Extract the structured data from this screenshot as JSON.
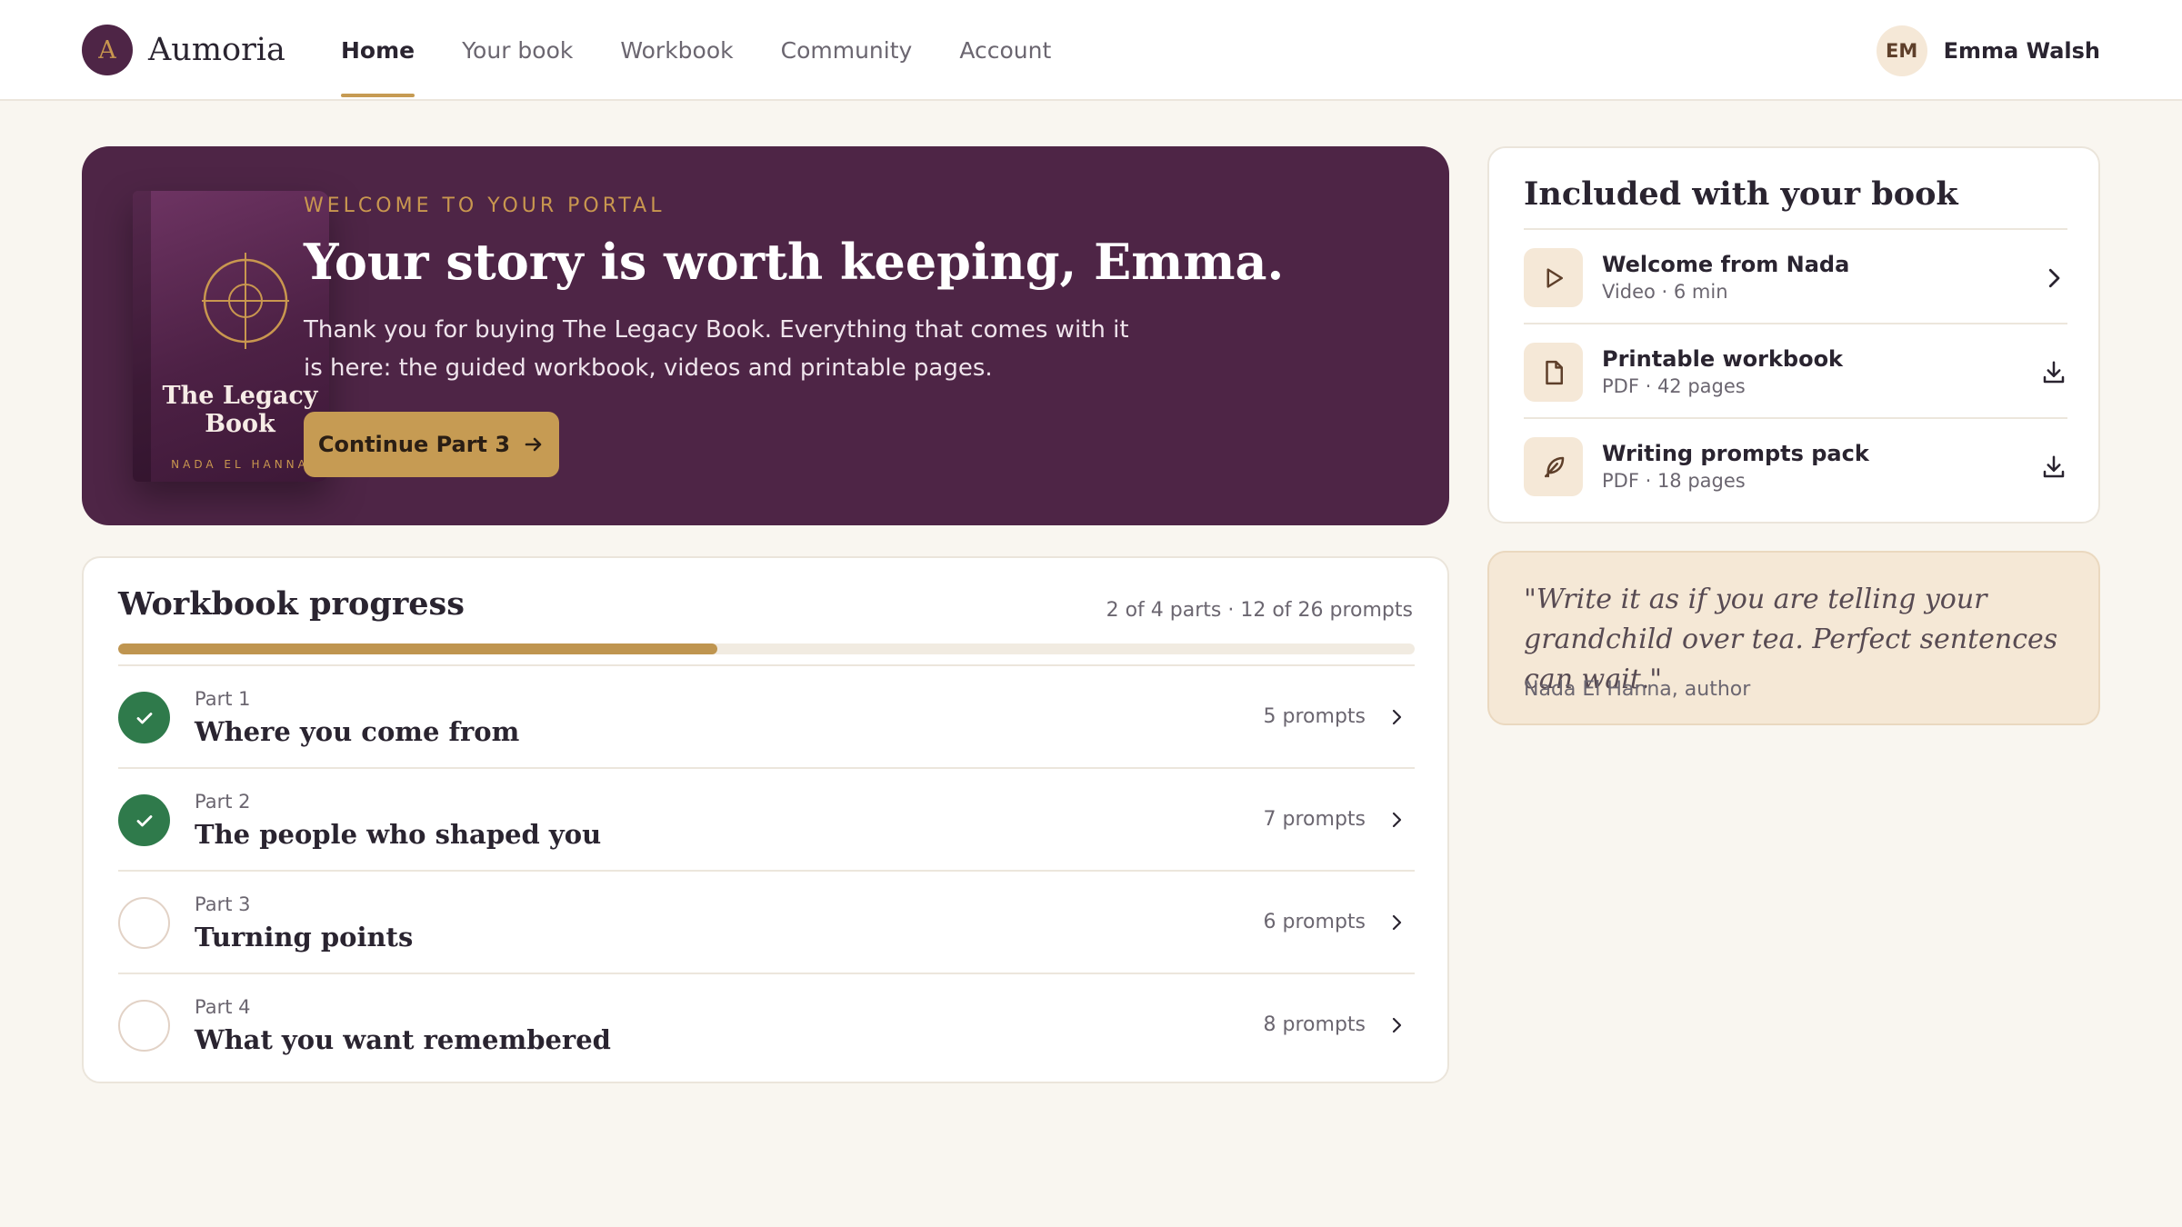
{
  "brand": {
    "logo_letter": "A",
    "name": "Aumoria"
  },
  "nav": {
    "items": [
      {
        "label": "Home",
        "active": true
      },
      {
        "label": "Your book",
        "active": false
      },
      {
        "label": "Workbook",
        "active": false
      },
      {
        "label": "Community",
        "active": false
      },
      {
        "label": "Account",
        "active": false
      }
    ]
  },
  "user": {
    "initials": "EM",
    "name": "Emma Walsh"
  },
  "hero": {
    "book_title_line1": "The Legacy",
    "book_title_line2": "Book",
    "book_author": "NADA EL HANNA",
    "eyebrow": "WELCOME TO YOUR PORTAL",
    "title": "Your story is worth keeping, Emma.",
    "description": "Thank you for buying The Legacy Book. Everything that comes with it is here: the guided workbook, videos and printable pages.",
    "cta_label": "Continue Part 3",
    "cta_icon": "arrow-right-icon"
  },
  "progress": {
    "heading": "Workbook progress",
    "summary": "2 of 4 parts · 12 of 26 prompts",
    "fraction": 0.462,
    "parts": [
      {
        "label": "Part 1",
        "title": "Where you come from",
        "count": "5 prompts",
        "done": true
      },
      {
        "label": "Part 2",
        "title": "The people who shaped you",
        "count": "7 prompts",
        "done": true
      },
      {
        "label": "Part 3",
        "title": "Turning points",
        "count": "6 prompts",
        "done": false
      },
      {
        "label": "Part 4",
        "title": "What you want remembered",
        "count": "8 prompts",
        "done": false
      }
    ]
  },
  "included": {
    "heading": "Included with your book",
    "items": [
      {
        "title": "Welcome from Nada",
        "meta": "Video · 6 min",
        "icon": "play-icon",
        "action_icon": "chevron-right-icon"
      },
      {
        "title": "Printable workbook",
        "meta": "PDF · 42 pages",
        "icon": "document-icon",
        "action_icon": "download-icon"
      },
      {
        "title": "Writing prompts pack",
        "meta": "PDF · 18 pages",
        "icon": "feather-icon",
        "action_icon": "download-icon"
      }
    ]
  },
  "quote": {
    "text": "\"Write it as if you are telling your grandchild over tea. Perfect sentences can wait.\"",
    "author": "Nada El Hanna, author"
  },
  "colors": {
    "plum": "#4e2546",
    "gold": "#c69b53",
    "success": "#2f7a4b",
    "background": "#f9f6f0",
    "quote_bg": "#f5e8d6"
  }
}
